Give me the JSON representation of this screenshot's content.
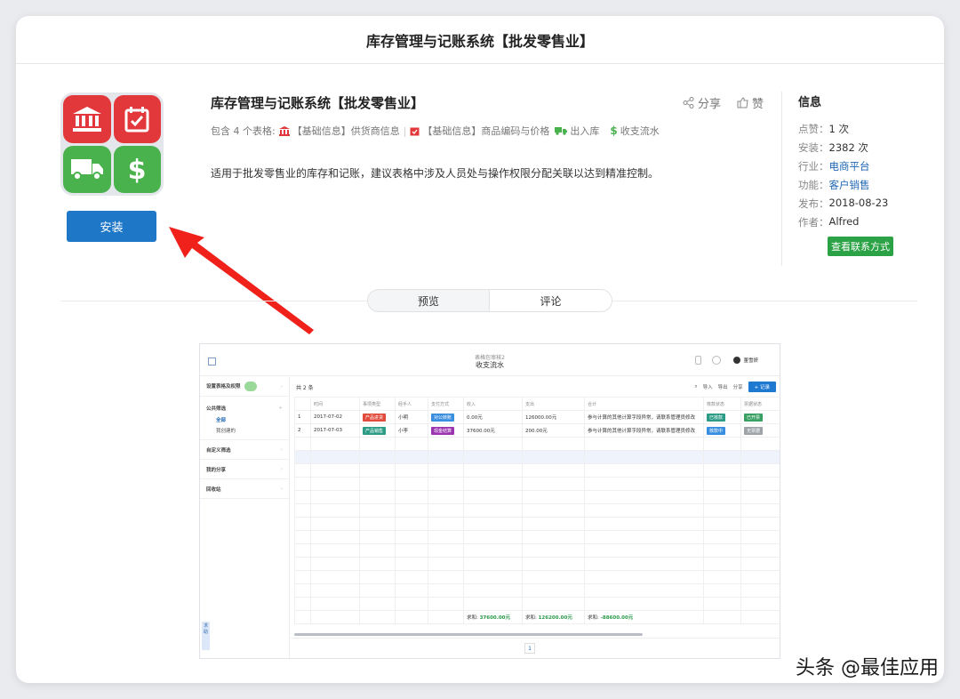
{
  "header": {
    "title": "库存管理与记账系统【批发零售业】"
  },
  "app": {
    "title": "库存管理与记账系统【批发零售业】",
    "install_label": "安装",
    "share_label": "分享",
    "like_label": "赞",
    "tables_prefix": "包含 4 个表格:",
    "tables": [
      {
        "icon": "bank-icon",
        "label": "【基础信息】供货商信息"
      },
      {
        "icon": "calendar-check-icon",
        "label": "【基础信息】商品编码与价格"
      },
      {
        "icon": "truck-icon",
        "label": "出入库"
      },
      {
        "icon": "dollar-icon",
        "label": "收支流水"
      }
    ],
    "description": "适用于批发零售业的库存和记账，建议表格中涉及人员处与操作权限分配关联以达到精准控制。",
    "colors": {
      "install": "#1f77c8",
      "red_tile": "#e2383b",
      "green_tile": "#49b24d",
      "contact": "#2ba245"
    }
  },
  "info": {
    "heading": "信息",
    "rows": [
      {
        "label": "点赞：",
        "value": "1 次"
      },
      {
        "label": "安装：",
        "value": "2382 次"
      },
      {
        "label": "行业：",
        "value": "电商平台"
      },
      {
        "label": "功能：",
        "value": "客户销售"
      },
      {
        "label": "发布：",
        "value": "2018-08-23"
      },
      {
        "label": "作者：",
        "value": "Alfred"
      }
    ],
    "contact_label": "查看联系方式"
  },
  "tabs": [
    {
      "label": "预览"
    },
    {
      "label": "评论"
    }
  ],
  "preview": {
    "subtitle": "表格包审核2",
    "name": "收支流水",
    "user": "董雪妍",
    "sidebar": {
      "settings": "设置表格及权限",
      "public_filter": "公共筛选",
      "all": "全部",
      "mine": "我创建的",
      "custom_filter": "自定义筛选",
      "my_share": "我的分享",
      "recycle": "回收站",
      "help": "求助"
    },
    "toolbar": {
      "count": "共 2 条",
      "import": "导入",
      "export": "导出",
      "share": "分享",
      "add": "+ 记录"
    },
    "columns": [
      "",
      "时间",
      "事项类型",
      "经手人",
      "支付方式",
      "收入",
      "支出",
      "合计",
      "核款状态",
      "票据状态"
    ],
    "rows": [
      {
        "no": "1",
        "date": "2017-07-02",
        "type": "产品进货",
        "person": "小明",
        "pay": "对公转账",
        "income": "0.00元",
        "expense": "126000.00元",
        "total": "参与计算的其他计算字段异常，请联系管理员修改",
        "check": "已核款",
        "bill": "已开票"
      },
      {
        "no": "2",
        "date": "2017-07-03",
        "type": "产品销售",
        "person": "小李",
        "pay": "现金结算",
        "income": "37600.00元",
        "expense": "200.00元",
        "total": "参与计算的其他计算字段异常，请联系管理员修改",
        "check": "核款中",
        "bill": "无票据"
      }
    ],
    "sums": {
      "label": "求和:",
      "income": "37600.00元",
      "expense": "126200.00元",
      "total": "-88600.00元"
    },
    "page": "1"
  },
  "watermark": "头条 @最佳应用"
}
